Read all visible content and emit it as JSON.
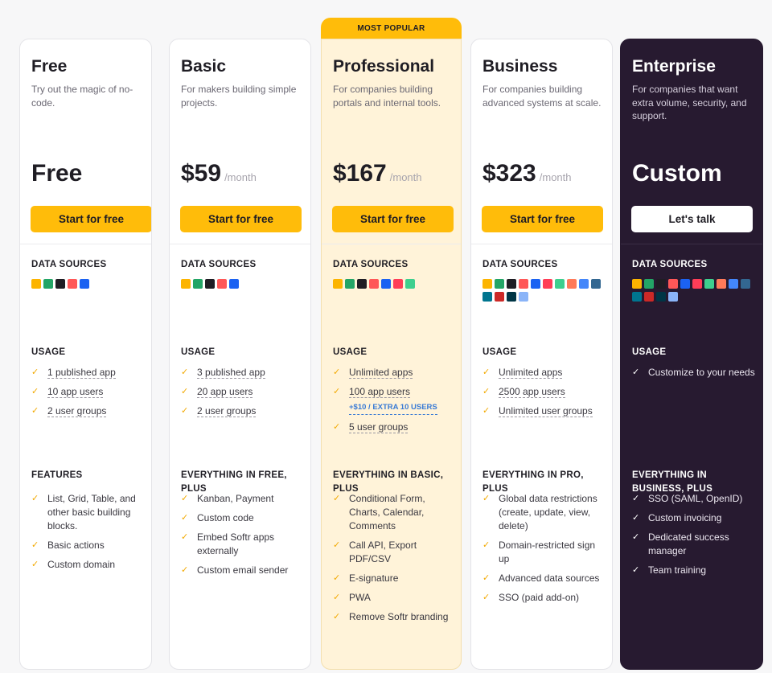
{
  "badge": "MOST POPULAR",
  "plans": [
    {
      "name": "Free",
      "desc": "Try out the magic of no-code.",
      "amount": "Free",
      "per": "",
      "cta": "Start for free",
      "ds_label": "DATA SOURCES",
      "usage_label": "USAGE",
      "usage": [
        {
          "t": "1 published app"
        },
        {
          "t": "10 app users"
        },
        {
          "t": "2 user groups"
        }
      ],
      "feat_label": "FEATURES",
      "features": [
        "List, Grid, Table, and other basic building blocks.",
        "Basic actions",
        "Custom domain"
      ]
    },
    {
      "name": "Basic",
      "desc": "For makers building simple projects.",
      "amount": "$59",
      "per": "/month",
      "cta": "Start for free",
      "ds_label": "DATA SOURCES",
      "usage_label": "USAGE",
      "usage": [
        {
          "t": "3 published app"
        },
        {
          "t": "20 app users"
        },
        {
          "t": "2 user groups"
        }
      ],
      "feat_label": "EVERYTHING IN FREE, PLUS",
      "features": [
        "Kanban, Payment",
        "Custom code",
        "Embed Softr apps externally",
        "Custom email sender"
      ]
    },
    {
      "name": "Professional",
      "desc": "For companies building portals and internal tools.",
      "amount": "$167",
      "per": "/month",
      "cta": "Start for free",
      "ds_label": "DATA SOURCES",
      "usage_label": "USAGE",
      "usage": [
        {
          "t": "Unlimited apps"
        },
        {
          "t": "100 app users",
          "sub": "+$10 / EXTRA 10 USERS"
        },
        {
          "t": "5 user groups"
        }
      ],
      "feat_label": "EVERYTHING IN BASIC, PLUS",
      "features": [
        "Conditional Form, Charts, Calendar, Comments",
        "Call API, Export PDF/CSV",
        "E-signature",
        "PWA",
        "Remove Softr branding"
      ]
    },
    {
      "name": "Business",
      "desc": "For companies building advanced systems at scale.",
      "amount": "$323",
      "per": "/month",
      "cta": "Start for free",
      "ds_label": "DATA SOURCES",
      "usage_label": "USAGE",
      "usage": [
        {
          "t": "Unlimited apps"
        },
        {
          "t": "2500 app users"
        },
        {
          "t": "Unlimited user groups"
        }
      ],
      "feat_label": "EVERYTHING IN PRO, PLUS",
      "features": [
        "Global data restrictions (create, update, view, delete)",
        "Domain-restricted sign up",
        "Advanced data sources",
        "SSO (paid add-on)"
      ]
    },
    {
      "name": "Enterprise",
      "desc": "For companies that want extra volume, security, and support.",
      "amount": "Custom",
      "per": "",
      "cta": "Let's talk",
      "ds_label": "DATA SOURCES",
      "usage_label": "USAGE",
      "usage": [
        {
          "t": "Customize to your needs"
        }
      ],
      "feat_label": "EVERYTHING IN BUSINESS, PLUS",
      "features": [
        "SSO (SAML, OpenID)",
        "Custom invoicing",
        "Dedicated success manager",
        "Team training"
      ]
    }
  ],
  "icon_sets": [
    [
      "airtable-icon",
      "google-sheets-icon",
      "notion-icon",
      "smartsuite-icon",
      "xano-icon"
    ],
    [
      "airtable-icon",
      "google-sheets-icon",
      "notion-icon",
      "smartsuite-icon",
      "xano-icon"
    ],
    [
      "airtable-icon",
      "google-sheets-icon",
      "notion-icon",
      "smartsuite-icon",
      "xano-icon",
      "monday-icon",
      "supabase-icon"
    ],
    [
      "airtable-icon",
      "google-sheets-icon",
      "notion-icon",
      "smartsuite-icon",
      "xano-icon",
      "monday-icon",
      "supabase-icon",
      "hubspot-icon",
      "bigquery-icon",
      "postgres-icon",
      "mysql-icon",
      "sqlserver-icon",
      "mariadb-icon",
      "rest-api-icon"
    ],
    [
      "airtable-icon",
      "google-sheets-icon",
      "notion-icon",
      "smartsuite-icon",
      "xano-icon",
      "monday-icon",
      "supabase-icon",
      "hubspot-icon",
      "bigquery-icon",
      "postgres-icon",
      "mysql-icon",
      "sqlserver-icon",
      "mariadb-icon",
      "rest-api-icon"
    ]
  ],
  "icon_colors": {
    "airtable-icon": "#fcb400",
    "google-sheets-icon": "#23a566",
    "notion-icon": "#1f1d24",
    "smartsuite-icon": "#ff5757",
    "xano-icon": "#1b62f2",
    "monday-icon": "#ff3d57",
    "supabase-icon": "#3ecf8e",
    "hubspot-icon": "#ff7a59",
    "bigquery-icon": "#4386fa",
    "postgres-icon": "#336791",
    "mysql-icon": "#00758f",
    "sqlserver-icon": "#cc2927",
    "mariadb-icon": "#003545",
    "rest-api-icon": "#8ab4f8"
  },
  "check_glyph": "✓"
}
